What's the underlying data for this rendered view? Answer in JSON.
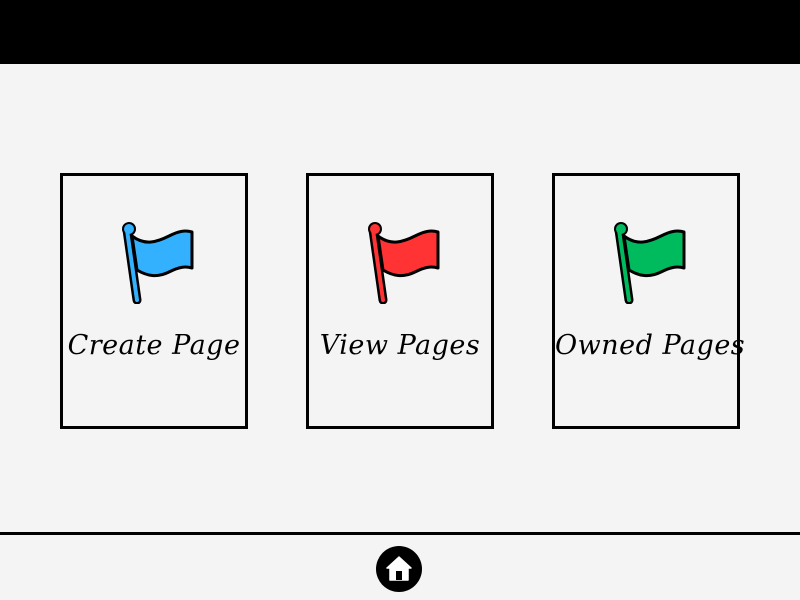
{
  "cards": [
    {
      "label": "Create Page",
      "flag_color": "#33b1ff",
      "icon": "flag-icon"
    },
    {
      "label": "View Pages",
      "flag_color": "#ff3333",
      "icon": "flag-icon"
    },
    {
      "label": "Owned Pages",
      "flag_color": "#00bb5e",
      "icon": "flag-icon"
    }
  ],
  "footer": {
    "home_icon": "home-icon"
  },
  "colors": {
    "background": "#f4f4f4",
    "top_bar": "#000000",
    "border": "#000000"
  }
}
